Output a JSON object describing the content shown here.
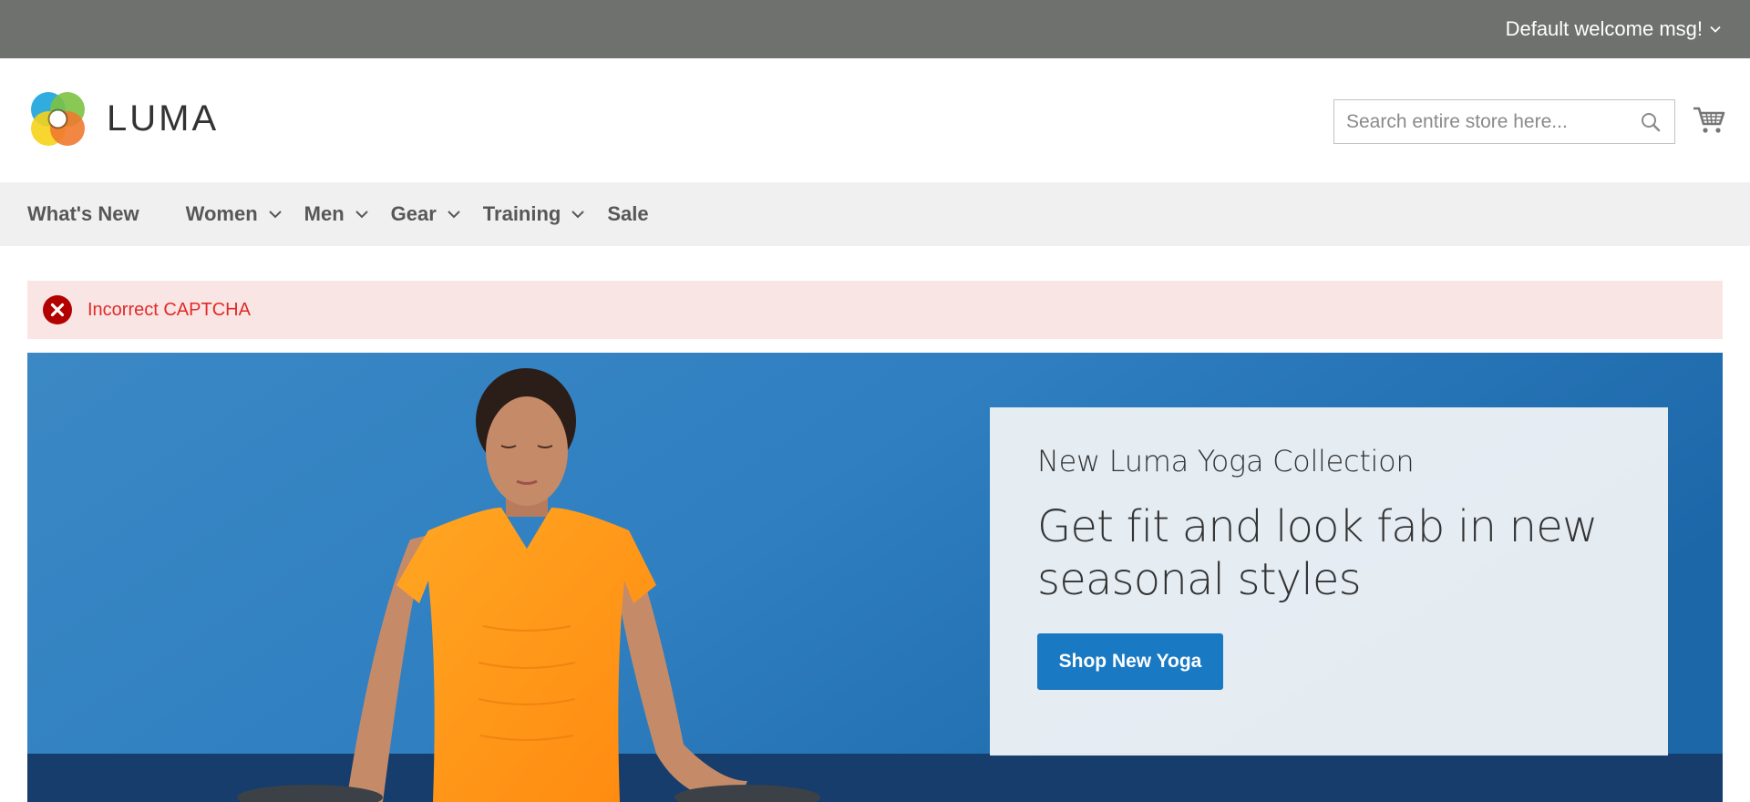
{
  "panel": {
    "welcome_text": "Default welcome msg!"
  },
  "header": {
    "logo_text": "LUMA",
    "search_placeholder": "Search entire store here...",
    "cart_icon": "cart-icon",
    "search_icon": "search-icon"
  },
  "nav": {
    "items": [
      {
        "label": "What's New",
        "has_dropdown": false
      },
      {
        "label": "Women",
        "has_dropdown": true
      },
      {
        "label": "Men",
        "has_dropdown": true
      },
      {
        "label": "Gear",
        "has_dropdown": true
      },
      {
        "label": "Training",
        "has_dropdown": true
      },
      {
        "label": "Sale",
        "has_dropdown": false
      }
    ]
  },
  "message": {
    "type": "error",
    "icon": "error-x-icon",
    "text": "Incorrect CAPTCHA"
  },
  "hero": {
    "kicker": "New Luma Yoga Collection",
    "headline": "Get fit and look fab in new seasonal styles",
    "button_label": "Shop New Yoga"
  },
  "colors": {
    "panel_bg": "#6e716e",
    "nav_bg": "#f0f0f0",
    "error_bg": "#fae5e5",
    "error_text": "#e02b27",
    "primary_button": "#1979c3"
  }
}
